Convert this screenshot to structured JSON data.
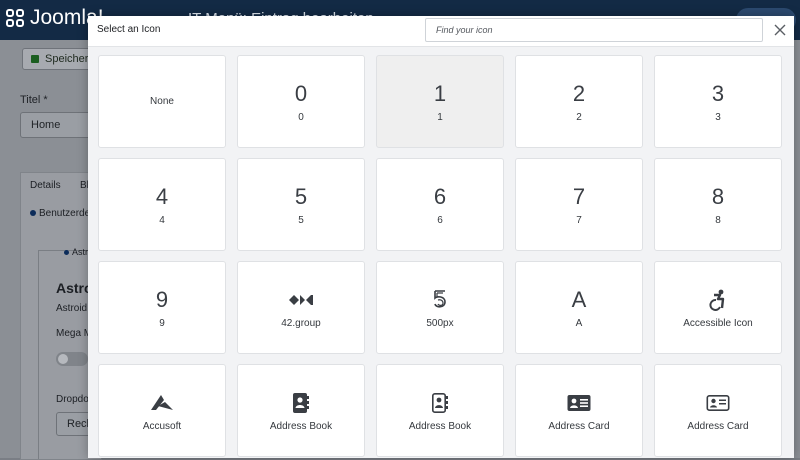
{
  "background": {
    "logo_text": "Joomla!",
    "page_title": "IT Menü: Eintrag bearbeiten",
    "save_button": "Speichern",
    "title_label": "Titel *",
    "title_value": "Home",
    "tab_details": "Details",
    "tab_second": "Bl",
    "user_type_label": "Benutzerde",
    "astroid_tab": "Astr",
    "astroid_heading": "Astro",
    "astroid_sub": "Astroid",
    "mega_menu_label": "Mega M",
    "dropdown_label": "Dropdo",
    "dropdown_value": "Rech"
  },
  "modal": {
    "title": "Select an Icon",
    "search_placeholder": "Find your icon",
    "search_value": "",
    "close_icon": "close-icon"
  },
  "icons": [
    {
      "label": "None",
      "glyph": ""
    },
    {
      "label": "0",
      "glyph": "0",
      "selected": false
    },
    {
      "label": "1",
      "glyph": "1",
      "selected": true
    },
    {
      "label": "2",
      "glyph": "2"
    },
    {
      "label": "3",
      "glyph": "3"
    },
    {
      "label": "4",
      "glyph": "4"
    },
    {
      "label": "5",
      "glyph": "5"
    },
    {
      "label": "6",
      "glyph": "6"
    },
    {
      "label": "7",
      "glyph": "7"
    },
    {
      "label": "8",
      "glyph": "8"
    },
    {
      "label": "9",
      "glyph": "9"
    },
    {
      "label": "42.group",
      "icon": "42-group-icon"
    },
    {
      "label": "500px",
      "icon": "500px-icon"
    },
    {
      "label": "A",
      "glyph": "A"
    },
    {
      "label": "Accessible Icon",
      "icon": "accessible-icon"
    },
    {
      "label": "Accusoft",
      "icon": "accusoft-icon"
    },
    {
      "label": "Address Book",
      "icon": "address-book-solid-icon"
    },
    {
      "label": "Address Book",
      "icon": "address-book-regular-icon"
    },
    {
      "label": "Address Card",
      "icon": "address-card-solid-icon"
    },
    {
      "label": "Address Card",
      "icon": "address-card-regular-icon"
    }
  ]
}
